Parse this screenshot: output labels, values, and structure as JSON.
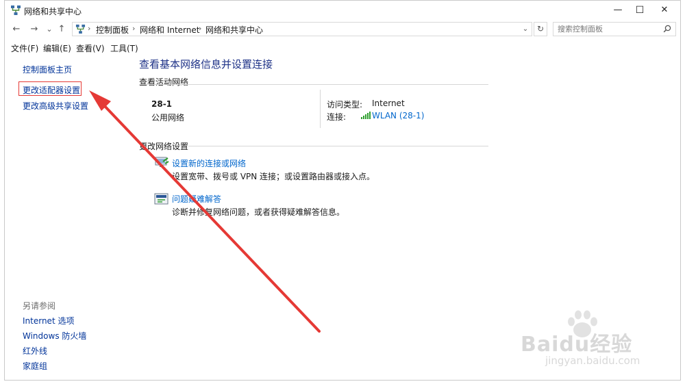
{
  "window": {
    "title": "网络和共享中心",
    "controls": {
      "minimize": "—",
      "maximize": "☐",
      "close": "✕"
    }
  },
  "address_bar": {
    "nav": {
      "back": "←",
      "forward": "→",
      "recent": "⌄",
      "up": "↑"
    },
    "breadcrumbs": [
      "控制面板",
      "网络和 Internet",
      "网络和共享中心"
    ],
    "separator": "›",
    "dropdown": "⌄",
    "refresh": "↻",
    "search_placeholder": "搜索控制面板"
  },
  "menu": [
    "文件(F)",
    "编辑(E)",
    "查看(V)",
    "工具(T)"
  ],
  "sidebar": {
    "links": [
      "控制面板主页",
      "更改适配器设置",
      "更改高级共享设置"
    ],
    "see_also_heading": "另请参阅",
    "see_also": [
      "Internet 选项",
      "Windows 防火墙",
      "红外线",
      "家庭组"
    ]
  },
  "main": {
    "title": "查看基本网络信息并设置连接",
    "active_networks_label": "查看活动网络",
    "network": {
      "name": "28-1",
      "category": "公用网络",
      "access_type_label": "访问类型:",
      "access_type_value": "Internet",
      "connection_label": "连接:",
      "connection_value": "WLAN (28-1)"
    },
    "change_settings_label": "更改网络设置",
    "tasks": [
      {
        "link": "设置新的连接或网络",
        "desc": "设置宽带、拨号或 VPN 连接；或设置路由器或接入点。",
        "icon": "network-setup-icon"
      },
      {
        "link": "问题疑难解答",
        "desc": "诊断并修复网络问题，或者获得疑难解答信息。",
        "icon": "troubleshoot-icon"
      }
    ]
  },
  "annotation": {
    "arrow_color": "#e53935",
    "highlight_color": "#e53935"
  },
  "watermark": {
    "main": "Baidu经验",
    "sub": "jingyan.baidu.com"
  },
  "colors": {
    "link": "#0066cc",
    "title": "#1e3287",
    "sidebar_link": "#003399"
  }
}
